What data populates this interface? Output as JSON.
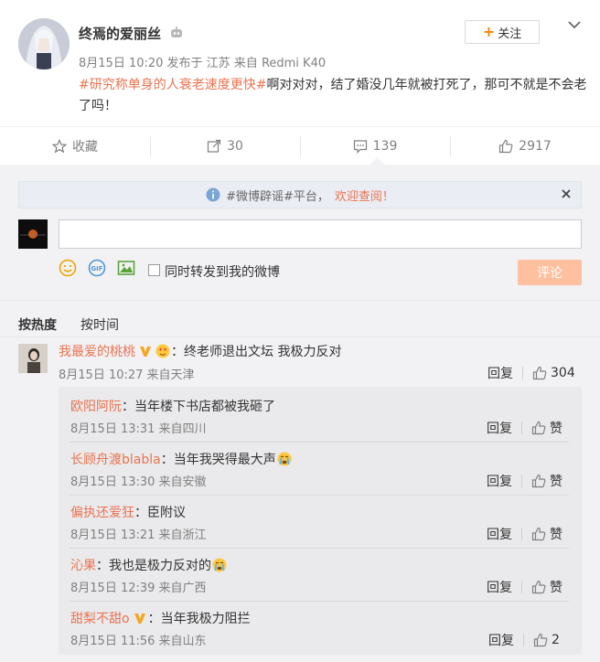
{
  "post": {
    "author": "终焉的爱丽丝",
    "meta": "8月15日 10:20 发布于 江苏 来自 Redmi K40",
    "topic": "#研究称单身的人衰老速度更快#",
    "text": "啊对对对，结了婚没几年就被打死了，那可不就是不会老了吗！",
    "follow_label": "关注"
  },
  "actions": {
    "favorite_label": "收藏",
    "repost_count": "30",
    "comment_count": "139",
    "like_count": "2917"
  },
  "rumor_notice": {
    "text": "#微博辟谣#平台，",
    "link": "欢迎查阅！"
  },
  "composer": {
    "placeholder": "",
    "repost_label": "同时转发到我的微博",
    "submit_label": "评论"
  },
  "sort": {
    "hot_label": "按热度",
    "time_label": "按时间"
  },
  "top_comment": {
    "user": "我最爱的桃桃",
    "text": "：终老师退出文坛 我极力反对",
    "meta": "8月15日 10:27 来自天津",
    "reply_label": "回复",
    "like_count": "304"
  },
  "replies": [
    {
      "user": "欧阳阿阮",
      "text": "：当年楼下书店都被我砸了",
      "meta": "8月15日 13:31 来自四川",
      "reply_label": "回复",
      "like": "赞"
    },
    {
      "user": "长顾舟渡blabla",
      "text": "：当年我哭得最大声",
      "meta": "8月15日 13:30 来自安徽",
      "reply_label": "回复",
      "like": "赞"
    },
    {
      "user": "偏执还爱狂",
      "text": "：臣附议",
      "meta": "8月15日 13:21 来自浙江",
      "reply_label": "回复",
      "like": "赞"
    },
    {
      "user": "沁果",
      "text": "：我也是极力反对的",
      "meta": "8月15日 12:39 来自广西",
      "reply_label": "回复",
      "like": "赞"
    },
    {
      "user": "甜梨不甜o",
      "text": "：当年我极力阻拦",
      "meta": "8月15日 11:56 来自山东",
      "reply_label": "回复",
      "like": "2"
    }
  ],
  "colors": {
    "accent": "#eb7350",
    "follow_plus": "#ff8200",
    "panel": "#f2f2f5",
    "submit_disabled": "#ffc09f",
    "verified": "#f5a623"
  }
}
